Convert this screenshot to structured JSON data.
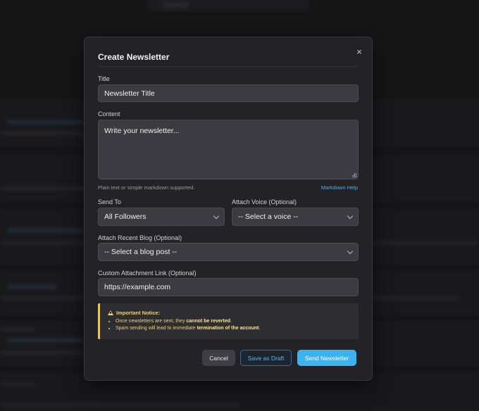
{
  "background": {
    "search_placeholder": "Search"
  },
  "modal": {
    "title": "Create Newsletter",
    "close_glyph": "×",
    "title_field": {
      "label": "Title",
      "placeholder": "Newsletter Title"
    },
    "content_field": {
      "label": "Content",
      "placeholder": "Write your newsletter..."
    },
    "content_hint": "Plain text or simple markdown supported.",
    "markdown_help": "Markdown Help",
    "send_to": {
      "label": "Send To",
      "selected": "All Followers"
    },
    "attach_voice": {
      "label": "Attach Voice (Optional)",
      "selected": "-- Select a voice --"
    },
    "attach_blog": {
      "label": "Attach Recent Blog (Optional)",
      "selected": "-- Select a blog post --"
    },
    "custom_link": {
      "label": "Custom Attachment Link (Optional)",
      "placeholder": "https://example.com"
    },
    "notice": {
      "title": "Important Notice:",
      "line1_prefix": "Once newsletters are sent, they ",
      "line1_bold": "cannot be reverted",
      "line1_suffix": ".",
      "line2_prefix": "Spam sending will lead to immediate ",
      "line2_bold": "termination of the account",
      "line2_suffix": "."
    },
    "buttons": {
      "cancel": "Cancel",
      "save_draft": "Save as Draft",
      "send": "Send Newsletter"
    }
  },
  "colors": {
    "accent": "#3fb2ee",
    "warning": "#f3d36a",
    "modal_bg": "#232327",
    "field_bg": "#3b3b41"
  },
  "icons": {
    "close": "close-icon",
    "warning": "warning-icon",
    "dropdown": "chevron-down-icon"
  }
}
